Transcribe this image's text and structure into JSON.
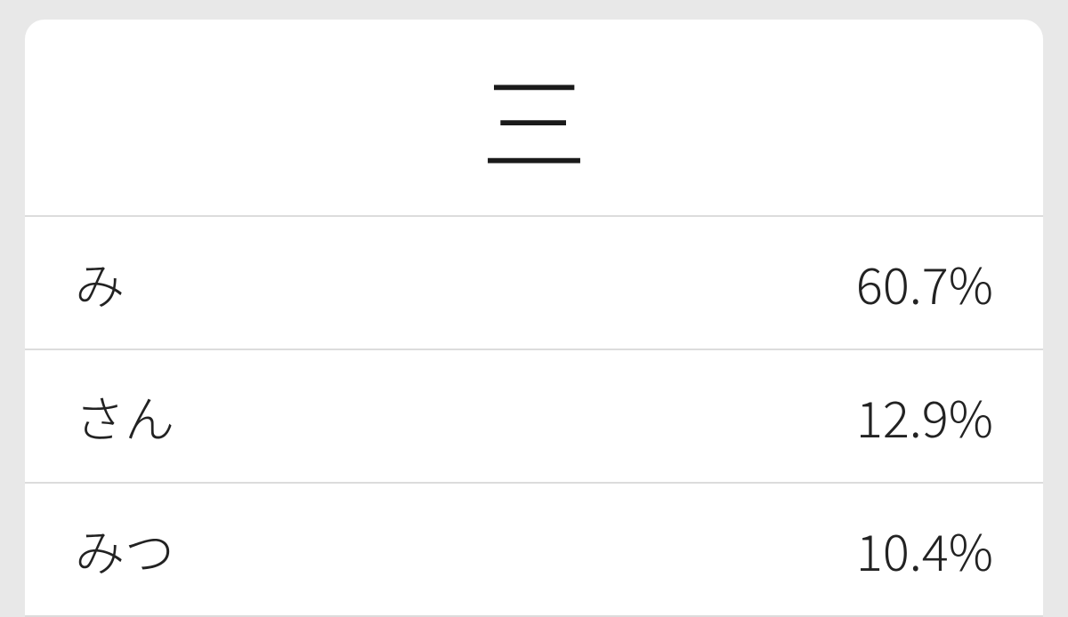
{
  "header": {
    "kanji": "三"
  },
  "readings": [
    {
      "text": "み",
      "percentage": "60.7%"
    },
    {
      "text": "さん",
      "percentage": "12.9%"
    },
    {
      "text": "みつ",
      "percentage": "10.4%"
    }
  ]
}
